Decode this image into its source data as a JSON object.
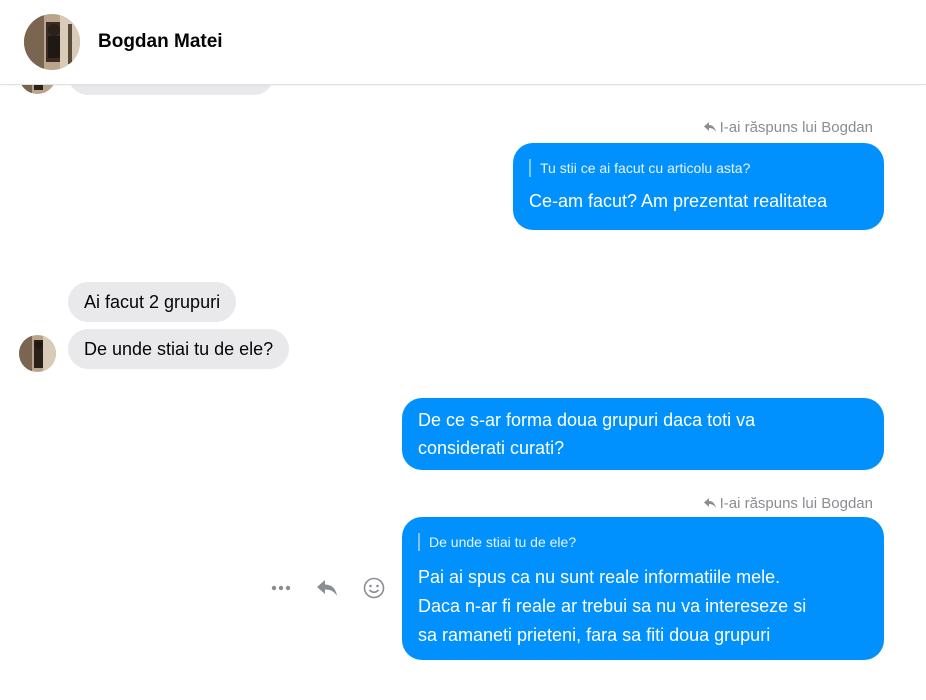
{
  "contact": {
    "name": "Bogdan Matei"
  },
  "messages": {
    "reply_note_1": "I-ai răspuns lui Bogdan",
    "out_1": {
      "quote": "Tu stii ce ai facut cu articolu asta?",
      "text": "Ce-am facut? Am prezentat realitatea"
    },
    "in_1": "Ai facut 2 grupuri",
    "in_2": "De unde stiai tu de ele?",
    "out_2_line1": "De ce s-ar forma doua grupuri daca toti va",
    "out_2_line2": "considerati curati?",
    "reply_note_2": "I-ai răspuns lui Bogdan",
    "out_3": {
      "quote": "De unde stiai tu de ele?",
      "line1": "Pai ai spus ca nu sunt reale informatiile mele.",
      "line2": "Daca n-ar fi reale ar trebui sa nu va intereseze si",
      "line3": "sa ramaneti prieteni, fara sa fiti doua grupuri"
    }
  },
  "icons": {
    "more": "more-options-icon",
    "reply": "reply-icon",
    "react": "emoji-reaction-icon",
    "reply_note": "reply-arrow-icon"
  },
  "colors": {
    "outgoing": "#0091ff",
    "incoming": "#e9e9ec",
    "meta_text": "#8a8d91"
  }
}
